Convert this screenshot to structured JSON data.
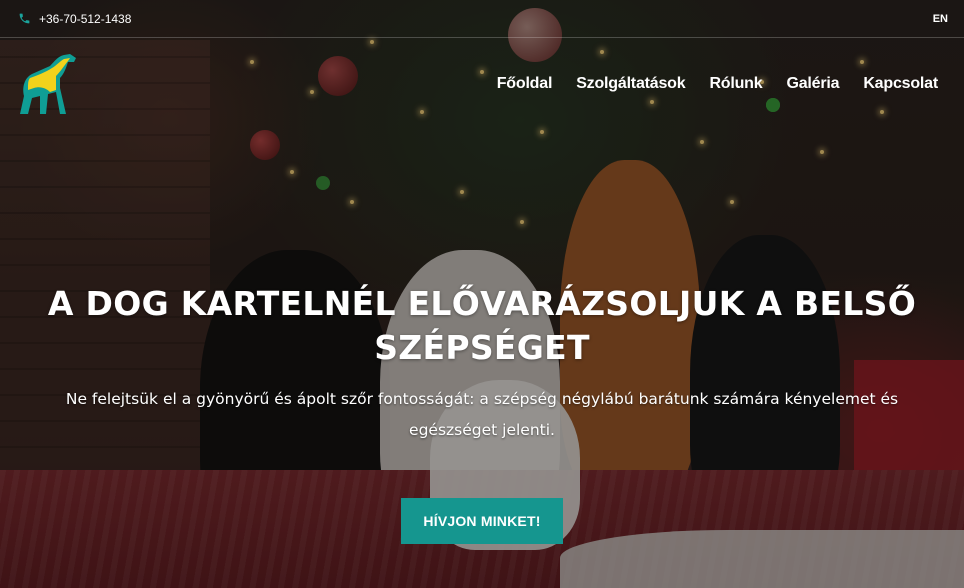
{
  "topbar": {
    "phone": "+36-70-512-1438",
    "language": "EN"
  },
  "nav": {
    "items": [
      {
        "label": "Főoldal"
      },
      {
        "label": "Szolgáltatások"
      },
      {
        "label": "Rólunk"
      },
      {
        "label": "Galéria"
      },
      {
        "label": "Kapcsolat"
      }
    ]
  },
  "hero": {
    "title": "A Dog Kartelnél elővarázsoljuk a belső szépséget",
    "subtitle": "Ne felejtsük el a gyönyörű és ápolt szőr fontosságát: a szépség négylábú barátunk számára kényelemet és egészséget jelenti.",
    "cta_label": "HÍVJON MINKET!"
  },
  "icons": {
    "phone": "phone-icon",
    "logo": "greyhound-logo-icon"
  },
  "colors": {
    "accent": "#15968f",
    "logo_teal": "#0f9e95",
    "logo_yellow": "#f1d21c"
  }
}
